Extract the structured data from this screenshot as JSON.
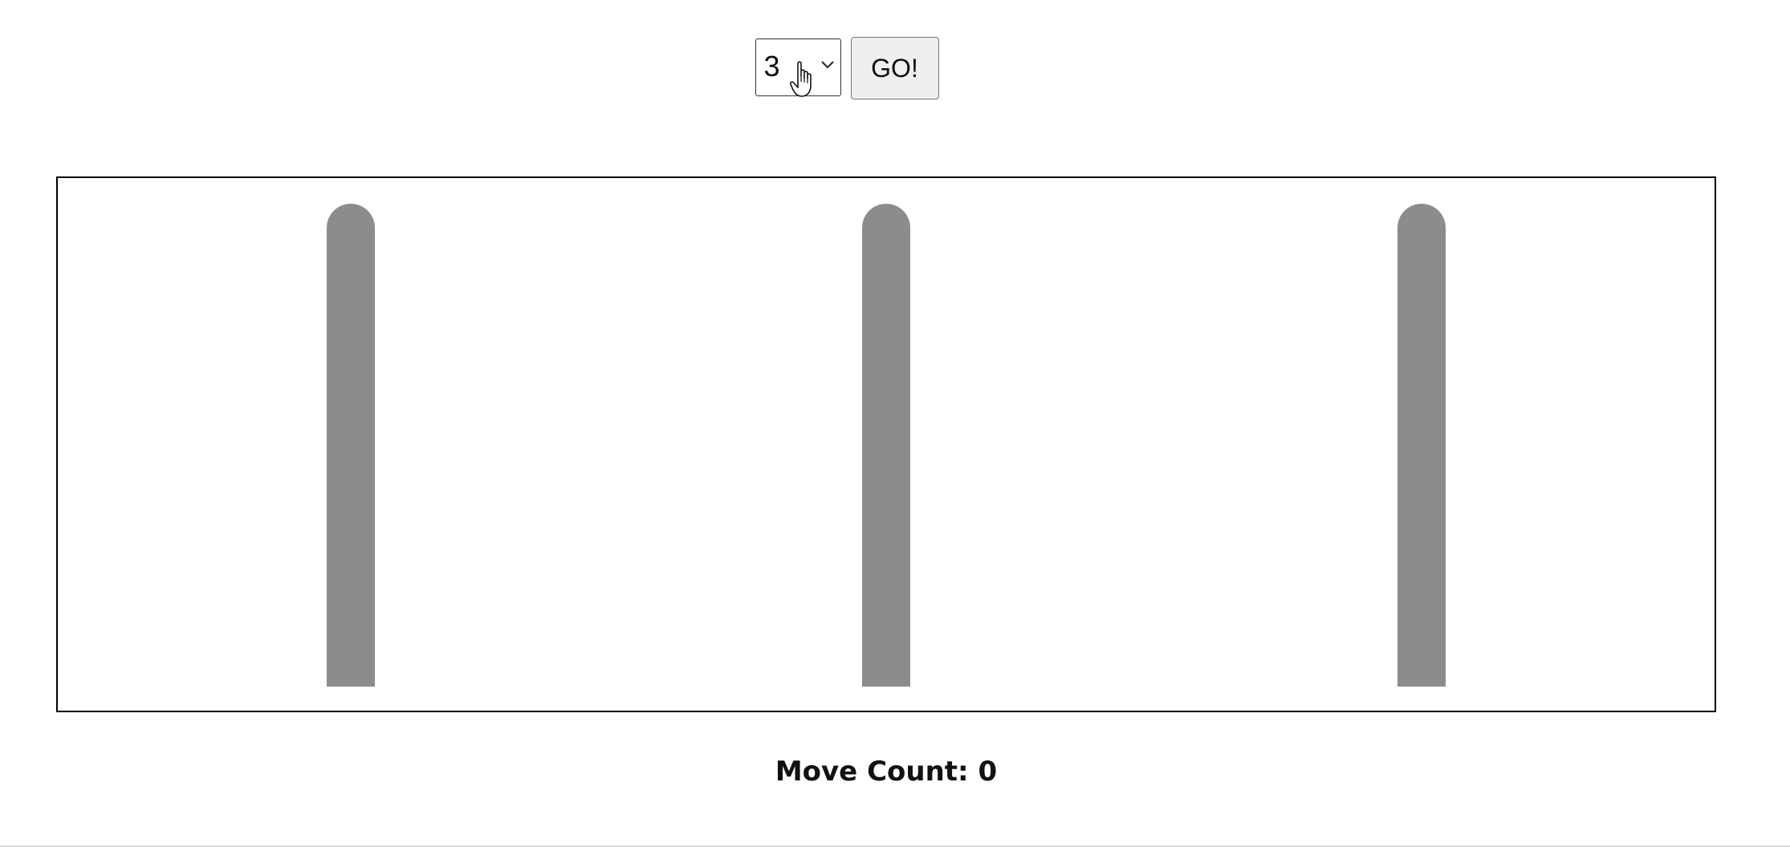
{
  "controls": {
    "disk_count_select": {
      "selected": "3"
    },
    "go_label": "GO!"
  },
  "board": {
    "pegs": 3,
    "colors": {
      "peg": "#8c8c8c",
      "border": "#000000"
    }
  },
  "status": {
    "move_count_label": "Move Count:",
    "move_count_value": "0"
  },
  "icons": {
    "select_arrow": "chevron-down-icon",
    "pointer": "hand-cursor-icon"
  }
}
